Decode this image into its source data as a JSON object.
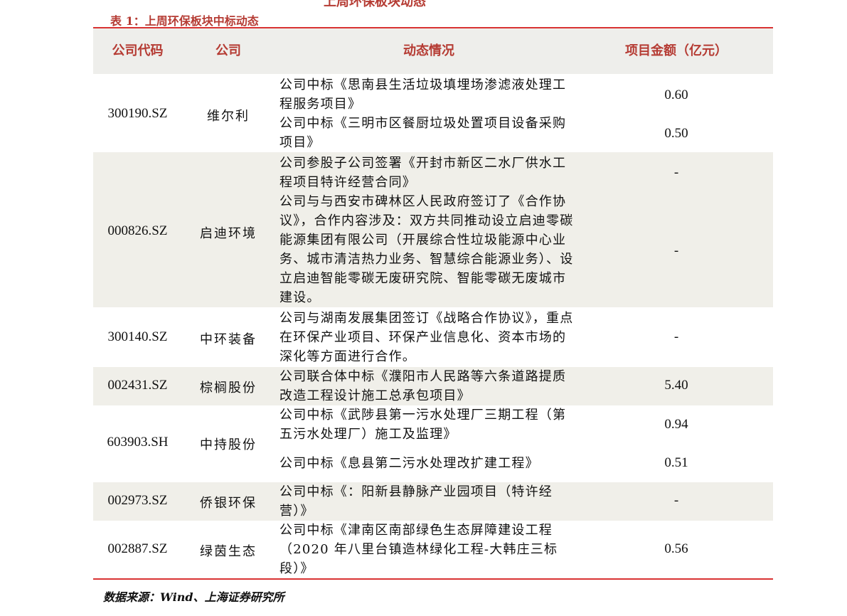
{
  "top_caption": "上周环保板块动态",
  "table_title": "表 1：上周环保板块中标动态",
  "headers": {
    "code": "公司代码",
    "company": "公司",
    "desc": "动态情况",
    "amount": "项目金额（亿元）"
  },
  "rows": [
    {
      "code": "300190.SZ",
      "company": "维尔利",
      "items": [
        {
          "desc": "公司中标《思南县生活垃圾填埋场渗滤液处理工程服务项目》",
          "amount": "0.60"
        },
        {
          "desc": "公司中标《三明市区餐厨垃圾处置项目设备采购项目》",
          "amount": "0.50"
        }
      ]
    },
    {
      "code": "000826.SZ",
      "company": "启迪环境",
      "items": [
        {
          "desc": "公司参股子公司签署《开封市新区二水厂供水工程项目特许经营合同》",
          "amount": "-"
        },
        {
          "desc": "公司与与西安市碑林区人民政府签订了《合作协议》，合作内容涉及：双方共同推动设立启迪零碳能源集团有限公司（开展综合性垃圾能源中心业务、城市清洁热力业务、智慧综合能源业务）、设立启迪智能零碳无废研究院、智能零碳无废城市建设。",
          "amount": "-"
        }
      ]
    },
    {
      "code": "300140.SZ",
      "company": "中环装备",
      "items": [
        {
          "desc": "公司与湖南发展集团签订《战略合作协议》，重点在环保产业项目、环保产业信息化、资本市场的深化等方面进行合作。",
          "amount": "-"
        }
      ]
    },
    {
      "code": "002431.SZ",
      "company": "棕榈股份",
      "items": [
        {
          "desc": "公司联合体中标《濮阳市人民路等六条道路提质改造工程设计施工总承包项目》",
          "amount": "5.40"
        }
      ]
    },
    {
      "code": "603903.SH",
      "company": "中持股份",
      "items": [
        {
          "desc": "公司中标《武陟县第一污水处理厂三期工程（第五污水处理厂）施工及监理》",
          "amount": "0.94"
        },
        {
          "desc": "公司中标《息县第二污水处理改扩建工程》",
          "amount": "0.51"
        }
      ]
    },
    {
      "code": "002973.SZ",
      "company": "侨银环保",
      "items": [
        {
          "desc": "公司中标《：阳新县静脉产业园项目（特许经营）》",
          "amount": "-"
        }
      ]
    },
    {
      "code": "002887.SZ",
      "company": "绿茵生态",
      "items": [
        {
          "desc": "公司中标《津南区南部绿色生态屏障建设工程（2020 年八里台镇造林绿化工程-大韩庄三标段）》",
          "amount": "0.56"
        }
      ]
    }
  ],
  "source": "数据来源：Wind、上海证券研究所"
}
